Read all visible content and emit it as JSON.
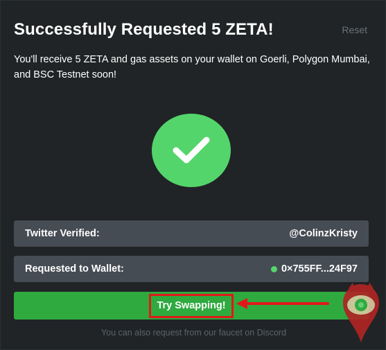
{
  "header": {
    "title": "Successfully Requested 5 ZETA!",
    "reset_label": "Reset"
  },
  "description": "You'll receive 5 ZETA and gas assets on your wallet on Goerli, Polygon Mumbai, and BSC Testnet soon!",
  "status_icon": "check-icon",
  "rows": {
    "twitter": {
      "label": "Twitter Verified:",
      "value": "@ColinzKristy"
    },
    "wallet": {
      "label": "Requested to Wallet:",
      "value": "0×755FF...24F97"
    }
  },
  "swap_button": {
    "label": "Try Swapping!"
  },
  "footer_note": "You can also request from our faucet on Discord",
  "colors": {
    "background": "#202426",
    "success_green": "#54d56b",
    "button_green": "#2faa3f",
    "row_gray": "#464c54",
    "annotation_red": "#e01818",
    "muted_text": "#6b7278"
  }
}
